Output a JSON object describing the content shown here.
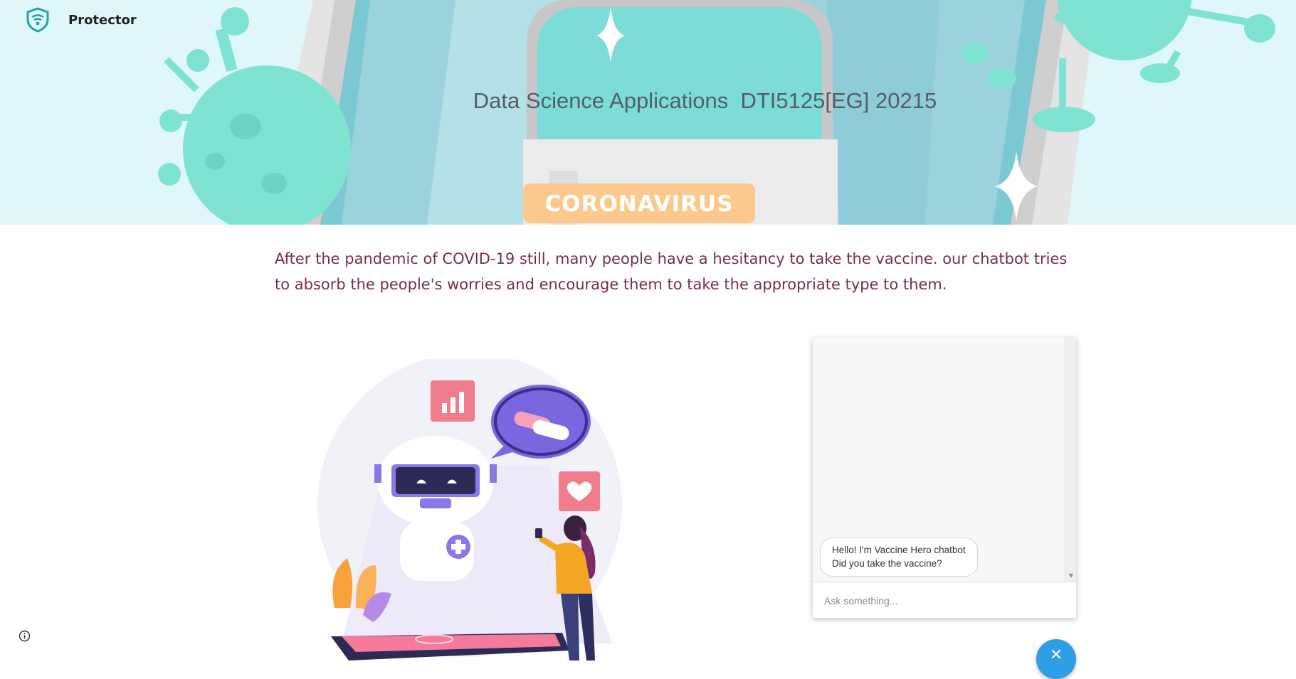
{
  "brand": {
    "name": "Protector",
    "logo_icon": "shield-icon"
  },
  "hero": {
    "title": "Data Science Applications  DTI5125[EG] 20215",
    "badge": "CORONAVIRUS"
  },
  "intro": {
    "text": "After the pandemic of COVID-19 still, many people have a hesitancy to take the vaccine. our chatbot tries to absorb the people's worries and encourage them to take the appropriate type to them."
  },
  "chat": {
    "messages": [
      {
        "from": "bot",
        "text": "Hello! I'm Vaccine Hero chatbot Did you take the vaccine?"
      }
    ],
    "input": {
      "placeholder": "Ask something...",
      "value": ""
    },
    "toggle_icon": "close-icon"
  },
  "footer": {
    "info_icon": "info-icon"
  },
  "colors": {
    "hero_bg": "#dff7f8",
    "virus": "#7fe3d2",
    "badge": "#fcc98d",
    "intro_text": "#7a2c4d",
    "fab": "#2f9de8"
  }
}
